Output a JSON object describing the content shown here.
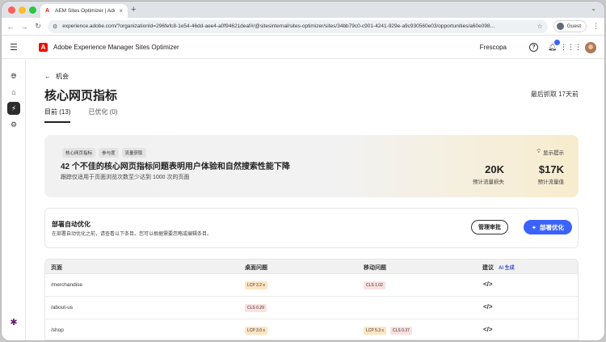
{
  "browser": {
    "tab_title": "AEM Sites Optimizer | Adobe",
    "tab_close": "×",
    "new_tab": "+",
    "url": "experience.adobe.com/?organizationId=296fefc8-1e54-46dd-aee4-a0f94621deaf#/@sitesinternal/sites-optimizer/sites/34bb79c0-c901-4241-929e-a9c930560e03/opportunities/a60e098...",
    "guest_label": "Guest"
  },
  "app": {
    "title": "Adobe Experience Manager Sites Optimizer",
    "logo_letter": "A",
    "org": "Frescopa"
  },
  "page": {
    "back_label": "机会",
    "title": "核心网页指标",
    "last_fetched": "最后抓取 17天前",
    "tabs": [
      {
        "label": "目前",
        "count": "(13)"
      },
      {
        "label": "已优化",
        "count": "(0)"
      }
    ]
  },
  "hero": {
    "chips": [
      "核心网页指标",
      "参与度",
      "流量获取"
    ],
    "headline": "42 个不佳的核心网页指标问题表明用户体验和自然搜索性能下降",
    "subtext": "跟踪仅适用于页面浏览次数至少达到 1000 次的页面",
    "hint": "显示提示",
    "metrics": [
      {
        "value": "20K",
        "label": "预计流量损失"
      },
      {
        "value": "$17K",
        "label": "预计流量值"
      }
    ]
  },
  "deploy": {
    "title": "部署自动优化",
    "description": "在部署自动优化之前，请查看以下条目。您可以根据需要忽略或编辑条目。",
    "review_button": "管理审批",
    "deploy_button": "部署优化"
  },
  "table": {
    "headers": {
      "page": "页面",
      "desktop": "桌面问题",
      "mobile": "移动问题",
      "suggestion": "建议",
      "ai": "AI 生成"
    },
    "rows": [
      {
        "page": "/merchandise",
        "desktop": [
          {
            "label": "LCP 3.2 s",
            "kind": "lcp"
          }
        ],
        "mobile": [
          {
            "label": "CLS 1.02",
            "kind": "cls"
          }
        ]
      },
      {
        "page": "/about-us",
        "desktop": [
          {
            "label": "CLS 0.29",
            "kind": "cls"
          }
        ],
        "mobile": []
      },
      {
        "page": "/shop",
        "desktop": [
          {
            "label": "LCP 3.0 s",
            "kind": "lcp"
          }
        ],
        "mobile": [
          {
            "label": "LCP 5.3 s",
            "kind": "lcp"
          },
          {
            "label": "CLS 0.37",
            "kind": "cls"
          }
        ]
      }
    ]
  },
  "colors": {
    "accent": "#3b63fb",
    "adobe_red": "#eb1000",
    "lcp_badge": "#ffe4c2",
    "cls_badge": "#fbe0df"
  }
}
